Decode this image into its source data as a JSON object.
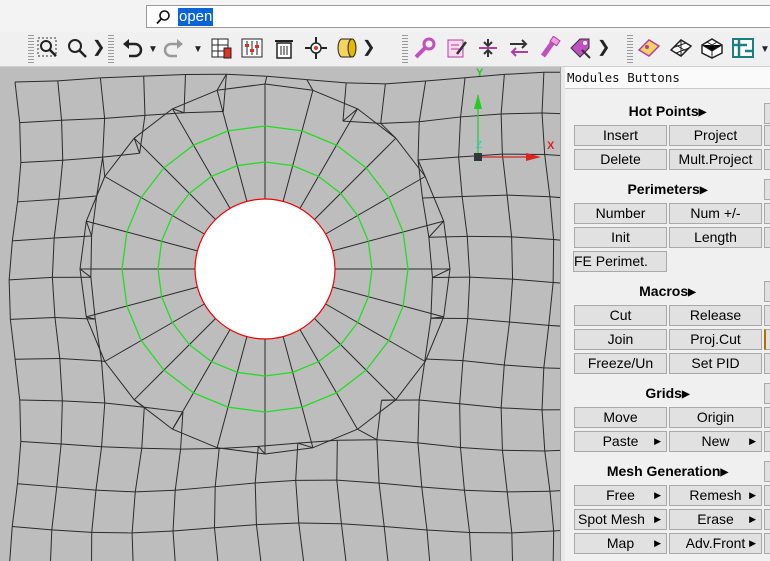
{
  "search": {
    "value": "open",
    "icon": "search-icon"
  },
  "toolbar": {
    "icons": [
      "zoom-window-icon",
      "zoom-icon",
      "undo-icon",
      "redo-icon",
      "grid-settings-icon",
      "sliders-icon",
      "delete-icon",
      "move-icon",
      "cylinder-icon",
      "wrench-icon",
      "edit-icon",
      "split-icon",
      "swap-icon",
      "brush-icon",
      "tag-icon",
      "surface-icon",
      "mesh-icon",
      "solid-mesh-icon",
      "structure-icon"
    ]
  },
  "viewport": {
    "axis_x_label": "X",
    "axis_y_label": "Y",
    "axis_z_label": "Z",
    "colors": {
      "background": "#bdbdbd",
      "mesh": "#2a2a2a",
      "ring": "#22dd22",
      "hole": "#ee0000"
    }
  },
  "panel": {
    "title": "Modules Buttons",
    "sections": [
      {
        "title": "Hot Points",
        "buttons": [
          "Insert",
          "Project",
          "Delete",
          "Mult.Project"
        ]
      },
      {
        "title": "Perimeters",
        "buttons": [
          "Number",
          "Num +/-",
          "Init",
          "Length",
          "FE Perimet."
        ]
      },
      {
        "title": "Macros",
        "buttons": [
          "Cut",
          "Release",
          "Join",
          "Proj.Cut",
          "Freeze/Un",
          "Set PID"
        ]
      },
      {
        "title": "Grids",
        "buttons": [
          "Move",
          "Origin",
          "Paste",
          "New"
        ]
      },
      {
        "title": "Mesh Generation",
        "buttons": [
          "Free",
          "Remesh",
          "Spot Mesh",
          "Erase",
          "Map",
          "Adv.Front"
        ]
      }
    ]
  }
}
